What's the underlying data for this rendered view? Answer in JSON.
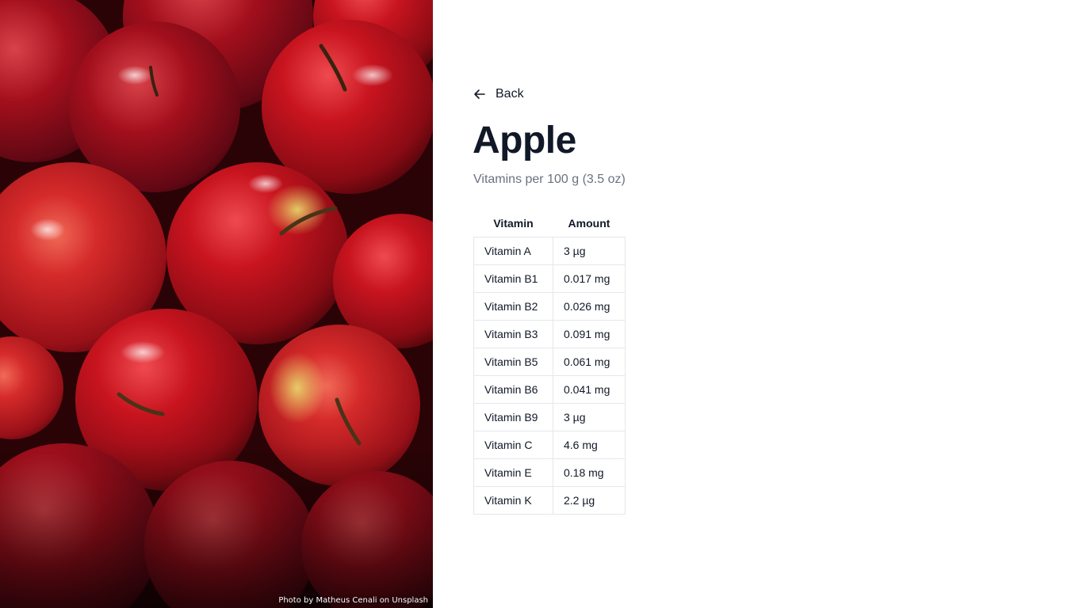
{
  "photo": {
    "credit": "Photo by Matheus Cenali on Unsplash"
  },
  "nav": {
    "back_label": "Back",
    "back_icon": "arrow-left-icon"
  },
  "product": {
    "title": "Apple",
    "subtitle": "Vitamins per 100 g (3.5 oz)"
  },
  "table": {
    "headers": {
      "vitamin": "Vitamin",
      "amount": "Amount"
    },
    "rows": [
      {
        "vitamin": "Vitamin A",
        "amount": "3 µg"
      },
      {
        "vitamin": "Vitamin B1",
        "amount": "0.017 mg"
      },
      {
        "vitamin": "Vitamin B2",
        "amount": "0.026 mg"
      },
      {
        "vitamin": "Vitamin B3",
        "amount": "0.091 mg"
      },
      {
        "vitamin": "Vitamin B5",
        "amount": "0.061 mg"
      },
      {
        "vitamin": "Vitamin B6",
        "amount": "0.041 mg"
      },
      {
        "vitamin": "Vitamin B9",
        "amount": "3 µg"
      },
      {
        "vitamin": "Vitamin C",
        "amount": "4.6 mg"
      },
      {
        "vitamin": "Vitamin E",
        "amount": "0.18 mg"
      },
      {
        "vitamin": "Vitamin K",
        "amount": "2.2 µg"
      }
    ]
  },
  "colors": {
    "text": "#111827",
    "muted": "#6b7280",
    "border": "#e5e7eb",
    "apple_red": "#b3121c",
    "apple_dark": "#5e0a12"
  }
}
